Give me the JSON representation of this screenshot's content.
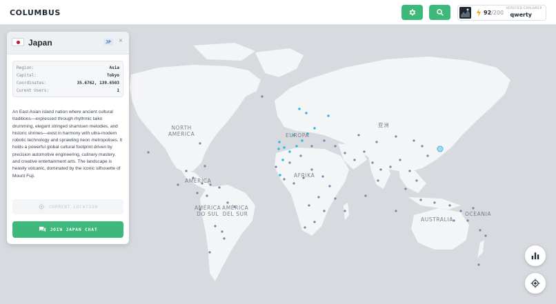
{
  "app": {
    "title": "COLUMBUS"
  },
  "header": {
    "settings_icon": "gear-icon",
    "search_icon": "search-icon",
    "energy_current": "92",
    "energy_max": "/200",
    "verified_label": "VERIFIED EXPLORER",
    "username": "qwerty"
  },
  "panel": {
    "country": "Japan",
    "code": "JP",
    "close": "×",
    "info": [
      {
        "key": "Region:",
        "value": "Asia"
      },
      {
        "key": "Capital:",
        "value": "Tokyo"
      },
      {
        "key": "Coordinates:",
        "value": "35.6762, 139.6503"
      },
      {
        "key": "Curent Users:",
        "value": "1"
      }
    ],
    "description": "An East Asian island nation where ancient cultural traditions—expressed through rhythmic taiko drumming, elegant stringed shamisen melodies, and historic shrines—exist in harmony with ultra-modern robotic technology and sprawling neon metropolises. It holds a powerful global cultural footprint driven by precision automotive engineering, culinary mastery, and creative entertainment arts. The landscape is heavily volcanic, dominated by the iconic silhouette of Mount Fuji.",
    "current_location_label": "CURRENT LOCATION",
    "chat_button_label": "JOIN JAPAN CHAT"
  },
  "map": {
    "labels": {
      "north_america": "NORTH\nAMERICA",
      "europe": "EUROPA",
      "asia": "亚洲",
      "africa": "AFRIKA",
      "america": "AMÉRICA",
      "south_america": "AMÉRICA\nDO SUL",
      "america_sur": "AMÉRICA\nDEL SUR",
      "australia": "AUSTRALIA",
      "oceania": "OCEANIA"
    }
  },
  "colors": {
    "accent": "#3fb87b",
    "map_land": "#f4f5f6",
    "map_water": "#d7dade",
    "marker": "#7b84a8",
    "marker_active": "#3ab8e0"
  }
}
